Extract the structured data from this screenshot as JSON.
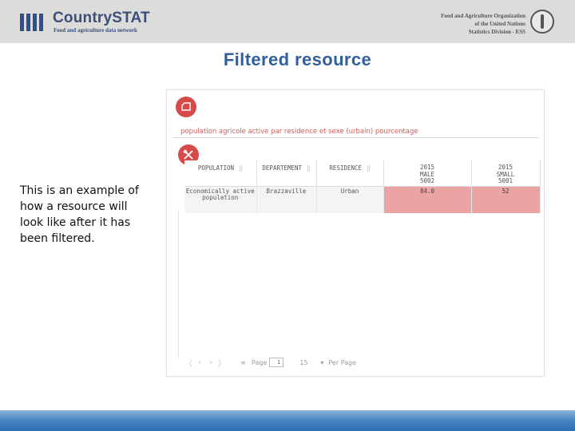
{
  "header": {
    "brand_name": "CountrySTAT",
    "brand_tagline": "Food and agriculture data network",
    "fao_lines": [
      "Food and Agriculture Organization",
      "of the United Nations",
      "Statistics Division - ESS"
    ]
  },
  "slide": {
    "title": "Filtered resource",
    "caption": "This is an example of how a resource will look like after it has been filtered."
  },
  "resource": {
    "title": "population agricole active par residence et sexe (urbain) pourcentage",
    "columns": [
      "POPULATION",
      "DEPARTEMENT",
      "RESIDENCE",
      "2015 MALE 5002",
      "2015 SMALL 5001"
    ],
    "rows": [
      {
        "population": "Economically active population",
        "departement": "Brazzaville",
        "residence": "Urban",
        "y1": "84.0",
        "y2": "52"
      }
    ],
    "highlight_color": "#eba3a3"
  },
  "pager": {
    "first": "〈",
    "prev": "‹",
    "next": "›",
    "last": "〉",
    "bars": "≡",
    "page_label": "Page",
    "page_value": "1",
    "page_size": "15",
    "page_size_arrow": "▾",
    "per_page_label": "Per Page"
  },
  "icons": {
    "top_button": "chart-icon",
    "filter_button": "filter-tools-icon"
  },
  "colors": {
    "accent_red": "#d64a4a",
    "title_blue": "#2f5f9d",
    "brand_blue": "#3a4f7a"
  }
}
